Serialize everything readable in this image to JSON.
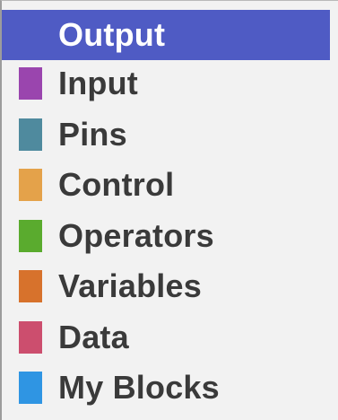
{
  "toolbox": {
    "categories": [
      {
        "label": "Output",
        "color": "#4f5bc4",
        "selected": true
      },
      {
        "label": "Input",
        "color": "#9a45ae",
        "selected": false
      },
      {
        "label": "Pins",
        "color": "#4f8a9e",
        "selected": false
      },
      {
        "label": "Control",
        "color": "#e4a24a",
        "selected": false
      },
      {
        "label": "Operators",
        "color": "#5aab2e",
        "selected": false
      },
      {
        "label": "Variables",
        "color": "#d7722c",
        "selected": false
      },
      {
        "label": "Data",
        "color": "#cc4e6e",
        "selected": false
      },
      {
        "label": "My Blocks",
        "color": "#2f95e3",
        "selected": false
      }
    ]
  }
}
